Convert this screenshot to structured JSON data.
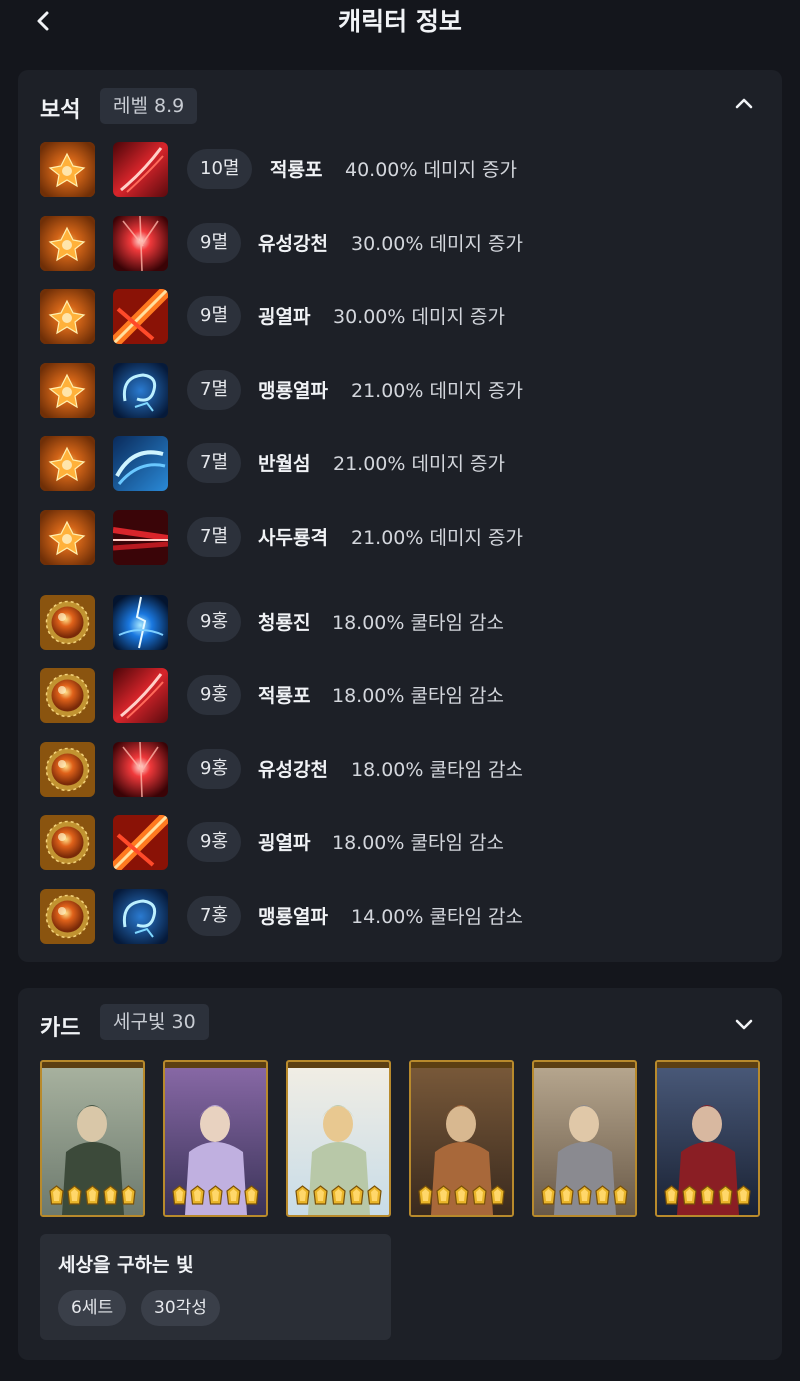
{
  "header": {
    "title": "캐릭터 정보"
  },
  "gems": {
    "title": "보석",
    "level": "레벨 8.9",
    "rows": [
      {
        "gem": "fire-gem",
        "skill_icon": "red-slash-skill-icon",
        "level": "10멸",
        "skill": "적룡포",
        "effect": "40.00% 데미지 증가"
      },
      {
        "gem": "fire-gem",
        "skill_icon": "red-burst-skill-icon",
        "level": "9멸",
        "skill": "유성강천",
        "effect": "30.00% 데미지 증가"
      },
      {
        "gem": "fire-gem",
        "skill_icon": "red-cross-skill-icon",
        "level": "9멸",
        "skill": "굉열파",
        "effect": "30.00% 데미지 증가"
      },
      {
        "gem": "fire-gem",
        "skill_icon": "blue-dragon-skill-icon",
        "level": "7멸",
        "skill": "맹룡열파",
        "effect": "21.00% 데미지 증가"
      },
      {
        "gem": "fire-gem",
        "skill_icon": "blue-wave-skill-icon",
        "level": "7멸",
        "skill": "반월섬",
        "effect": "21.00% 데미지 증가"
      },
      {
        "gem": "fire-gem",
        "skill_icon": "red-thrust-skill-icon",
        "level": "7멸",
        "skill": "사두룡격",
        "effect": "21.00% 데미지 증가"
      },
      {
        "gem": "orb-gem",
        "skill_icon": "blue-lightning-skill-icon",
        "level": "9홍",
        "skill": "청룡진",
        "effect": "18.00% 쿨타임 감소"
      },
      {
        "gem": "orb-gem",
        "skill_icon": "red-slash-skill-icon",
        "level": "9홍",
        "skill": "적룡포",
        "effect": "18.00% 쿨타임 감소"
      },
      {
        "gem": "orb-gem",
        "skill_icon": "red-burst-skill-icon",
        "level": "9홍",
        "skill": "유성강천",
        "effect": "18.00% 쿨타임 감소"
      },
      {
        "gem": "orb-gem",
        "skill_icon": "red-cross-skill-icon",
        "level": "9홍",
        "skill": "굉열파",
        "effect": "18.00% 쿨타임 감소"
      },
      {
        "gem": "orb-gem",
        "skill_icon": "blue-dragon-skill-icon",
        "level": "7홍",
        "skill": "맹룡열파",
        "effect": "14.00% 쿨타임 감소"
      }
    ]
  },
  "cards": {
    "title": "카드",
    "badge": "세구빛 30",
    "items": [
      {
        "portrait": "elf-sage-card",
        "awakening": 5
      },
      {
        "portrait": "twin-queens-card",
        "awakening": 5
      },
      {
        "portrait": "angel-card",
        "awakening": 5
      },
      {
        "portrait": "dwarf-warrior-card",
        "awakening": 5
      },
      {
        "portrait": "knight-card",
        "awakening": 5
      },
      {
        "portrait": "swordsman-card",
        "awakening": 5
      }
    ],
    "set": {
      "name": "세상을 구하는 빛",
      "pieces": "6세트",
      "awaken": "30각성"
    }
  },
  "colors": {
    "background": "#14161c",
    "panel": "#1d2027",
    "pill": "#2c313b",
    "card_border": "#b88a2c"
  }
}
